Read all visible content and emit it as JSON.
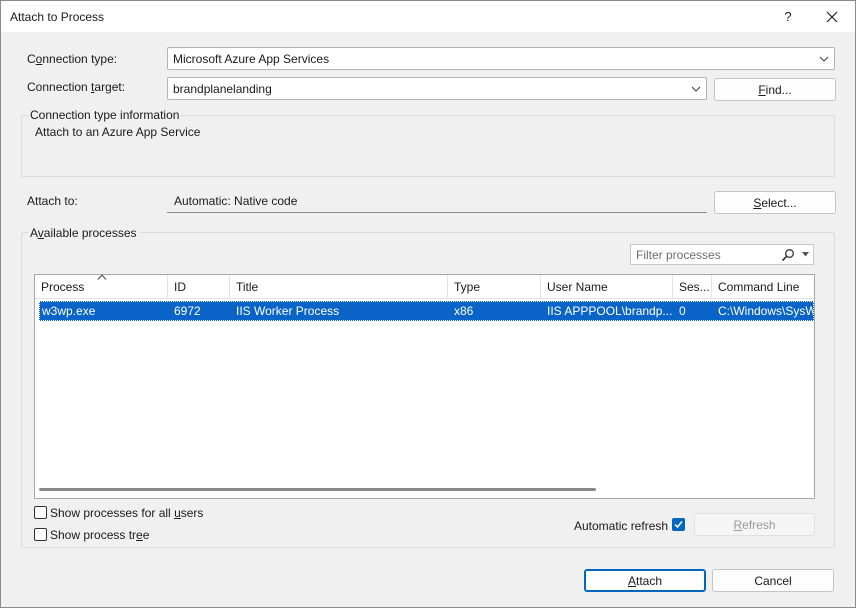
{
  "window": {
    "title": "Attach to Process",
    "help_glyph": "?"
  },
  "connection_type": {
    "label_pre": "C",
    "label_ul": "o",
    "label_post": "nnection type:",
    "value": "Microsoft Azure App Services"
  },
  "connection_target": {
    "label_pre": "Connection ",
    "label_ul": "t",
    "label_post": "arget:",
    "value": "brandplanelanding"
  },
  "find_button": {
    "label_ul": "F",
    "label_post": "ind..."
  },
  "type_info": {
    "title": "Connection type information",
    "text": "Attach to an Azure App Service"
  },
  "attach_to": {
    "label": "Attach to:",
    "value": "Automatic: Native code"
  },
  "select_button": {
    "label_ul": "S",
    "label_post": "elect..."
  },
  "available": {
    "title_pre": "A",
    "title_ul": "v",
    "title_post": "ailable processes"
  },
  "filter": {
    "placeholder": "Filter processes"
  },
  "table": {
    "columns": [
      "Process",
      "ID",
      "Title",
      "Type",
      "User Name",
      "Ses...",
      "Command Line"
    ],
    "rows": [
      {
        "process": "w3wp.exe",
        "id": "6972",
        "title": "IIS Worker Process",
        "type": "x86",
        "user": "IIS APPPOOL\\brandp...",
        "session": "0",
        "command": "C:\\Windows\\SysW"
      }
    ]
  },
  "options": {
    "all_users_pre": "Show processes for all ",
    "all_users_ul": "u",
    "all_users_post": "sers",
    "tree_pre": "Show process tr",
    "tree_ul": "e",
    "tree_post": "e",
    "auto_refresh": "Automatic refresh",
    "auto_refresh_checked": true,
    "all_users_checked": false,
    "tree_checked": false
  },
  "refresh_button": {
    "label_ul": "R",
    "label_post": "efresh"
  },
  "attach_button": {
    "label_ul": "A",
    "label_post": "ttach"
  },
  "cancel_button": {
    "label": "Cancel"
  },
  "colors": {
    "selection": "#0a64c8",
    "accent": "#0067c0"
  }
}
